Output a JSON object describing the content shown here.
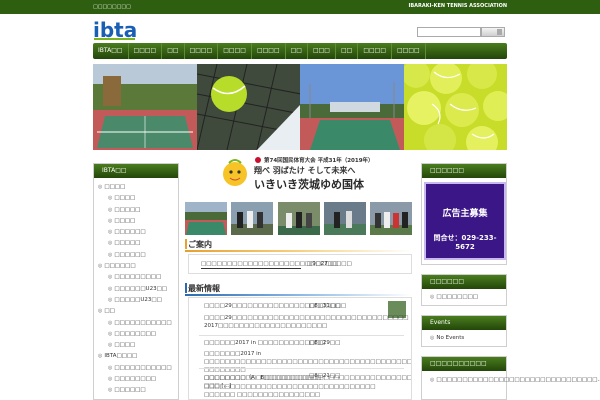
{
  "topbar": {
    "left_text": "□□□□□□□□",
    "right_text": "IBARAKI-KEN TENNIS ASSOCIATION"
  },
  "logo": {
    "text": "ibta",
    "color": "#1a5fb4"
  },
  "nav": {
    "items": [
      "IBTA□□",
      "□□□□",
      "□□",
      "□□□□",
      "□□□□",
      "□□□□",
      "□□",
      "□□□",
      "□□",
      "□□□□",
      "□□□□"
    ]
  },
  "banner": {
    "line1": "第74回国民体育大会 平成31年（2019年）",
    "line2": "翔べ 羽ばたけ そして未来へ",
    "line3": "いきいき茨城ゆめ国体"
  },
  "sidebar_left": {
    "title": "IBTA□□",
    "items": [
      {
        "level": 1,
        "label": "□□□□"
      },
      {
        "level": 2,
        "label": "□□□□"
      },
      {
        "level": 2,
        "label": "□□□□□"
      },
      {
        "level": 2,
        "label": "□□□□"
      },
      {
        "level": 2,
        "label": "□□□□□□"
      },
      {
        "level": 2,
        "label": "□□□□□"
      },
      {
        "level": 2,
        "label": "□□□□□□"
      },
      {
        "level": 1,
        "label": "□□□□□□"
      },
      {
        "level": 2,
        "label": "□□□□□□□□□"
      },
      {
        "level": 2,
        "label": "□□□□□□U23□□"
      },
      {
        "level": 2,
        "label": "□□□□□U23□□"
      },
      {
        "level": 1,
        "label": "□□"
      },
      {
        "level": 2,
        "label": "□□□□□□□□□□□"
      },
      {
        "level": 2,
        "label": "□□□□□□□□"
      },
      {
        "level": 2,
        "label": "□□□□"
      },
      {
        "level": 1,
        "label": "IBTA□□□□"
      },
      {
        "level": 2,
        "label": "□□□□□□□□□□□"
      },
      {
        "level": 2,
        "label": "□□□□□□□□"
      },
      {
        "level": 2,
        "label": "□□□□□□"
      }
    ]
  },
  "notice": {
    "title": "ご案内",
    "link_text": "□□□□□□□□□□□□□□□□□□□□□□□□□□□□□",
    "date": "□9□27□□"
  },
  "news": {
    "title": "最新情報",
    "items": [
      {
        "head": "□□□□29□□□□□□□□□□□□□□□□□□□□□□",
        "date": "□8□31□□",
        "body": "□□□□29□□□□□□□□□□□□□□□□□□□□□□□□□□□□□□□□□□ 2017□□□□□□□□□□□□□□□□□□□□□"
      },
      {
        "head": "□□□□□□2017 in □□□□□□□□□□□□□",
        "date": "□8□29□□",
        "body": "□□□□□□□2017 in □□□□□□□□□□□□□□□□□□□□□□□□□□□□□□□□□□□□□□□□□ □□□□□□□□ □□□□□□□□□□□□□□□□□□□□□□□□□□□□□□□□□□□□□□□□□□□□□□□□ □□□ […]"
      },
      {
        "head": "□□□□□□□□（A　B□□□□□□□□□□□",
        "date": "□8□21□□",
        "body": "□□□□□□□□□□□□□□□□□□□□□□□□□□□□□□□□□ □□□□□□ □□□□□□□□□□□□□□□□"
      }
    ]
  },
  "sidebar_right": {
    "ad_head": "□□□□□□",
    "ad_line1": "広告主募集",
    "ad_line2": "問合せ：029-233-5672",
    "box2_head": "□□□□□□",
    "box2_item": "□□□□□□□□",
    "events_head": "Events",
    "events_item": "No Events",
    "box4_head": "□□□□□□□□□□",
    "box4_item": "□□□□□□□□□□□□□□□□□□□□□□□□□□□□□□□..."
  }
}
